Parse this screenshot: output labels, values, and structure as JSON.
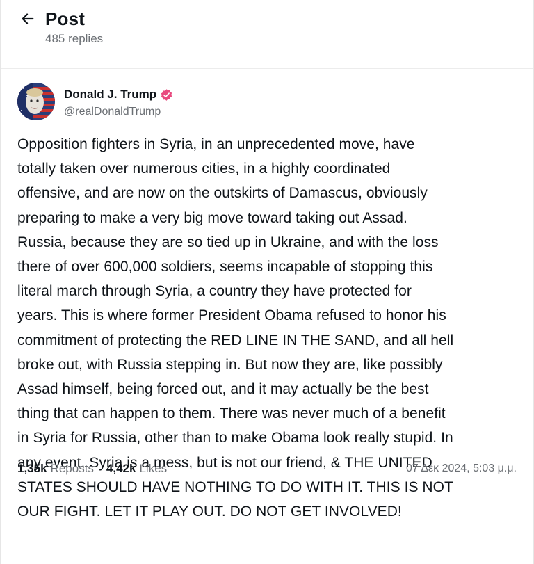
{
  "header": {
    "title": "Post",
    "replies": "485 replies",
    "back_icon": "arrow-left-icon"
  },
  "post": {
    "author": {
      "name": "Donald J. Trump",
      "handle": "@realDonaldTrump",
      "verified_icon": "verified-badge-icon",
      "verified_color": "#e84a7f"
    },
    "body_lines": [
      "Opposition fighters in Syria, in an unprecedented move, have",
      "totally taken over numerous cities, in a highly coordinated",
      "offensive, and are now on the outskirts of Damascus, obviously",
      "preparing to make a very big move toward taking out Assad.",
      "Russia, because they are so tied up in Ukraine, and with the loss",
      "there of over 600,000 soldiers, seems incapable of stopping this",
      "literal march through Syria, a country they have protected for",
      "years. This is where former President Obama refused to honor his",
      "commitment of protecting the RED LINE IN THE SAND, and all hell",
      "broke out, with Russia stepping in. But now they are, like possibly",
      "Assad himself, being forced out, and it may actually be the best",
      "thing that can happen to them. There was never much of a benefit",
      "in Syria for Russia, other than to make Obama look really stupid. In",
      "any event, Syria is a mess, but is not our friend, & THE UNITED",
      "STATES SHOULD HAVE NOTHING TO DO WITH IT. THIS IS NOT",
      "OUR FIGHT. LET IT PLAY OUT. DO NOT GET INVOLVED!"
    ],
    "stats": {
      "reposts_count": "1,35k",
      "reposts_label": "Reposts",
      "likes_count": "4,42k",
      "likes_label": "Likes"
    },
    "timestamp": "07 Δεκ 2024, 5:03 μ.μ."
  }
}
